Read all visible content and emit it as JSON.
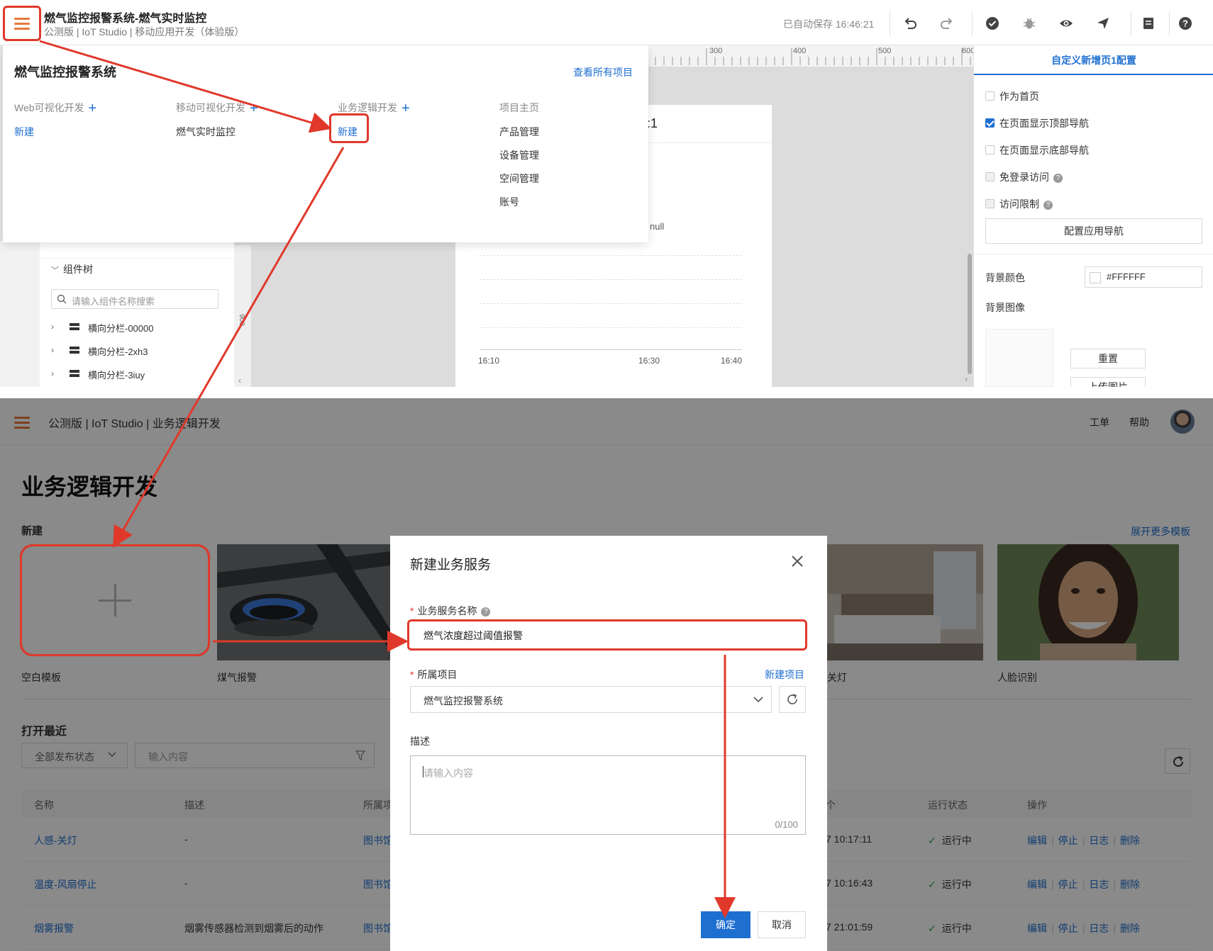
{
  "top": {
    "title": "燃气监控报警系统-燃气实时监控",
    "subtitle": "公测版 | IoT Studio | 移动应用开发（体验版）",
    "autosave": "已自动保存 16:46:21",
    "toolbar_icons": [
      "undo-icon",
      "redo-icon",
      "check-circle-icon",
      "bug-icon",
      "eye-icon",
      "send-icon",
      "document-icon",
      "help-icon"
    ],
    "ruler_ticks": [
      "300",
      "400",
      "500",
      "600"
    ],
    "canvas": {
      "page_header_fragment": ":1",
      "null_text": "null",
      "x_ticks": [
        "16:10",
        "16:30",
        "16:40"
      ],
      "vertical_ruler_label": "900"
    },
    "component_tree": {
      "title": "组件树",
      "search_placeholder": "请输入组件名称搜索",
      "items": [
        {
          "label": "横向分栏-00000"
        },
        {
          "label": "横向分栏-2xh3"
        },
        {
          "label": "横向分栏-3iuy"
        }
      ]
    },
    "right_panel": {
      "title": "自定义新增页1配置",
      "options": [
        {
          "label": "作为首页",
          "checked": false
        },
        {
          "label": "在页面显示顶部导航",
          "checked": true
        },
        {
          "label": "在页面显示底部导航",
          "checked": false
        },
        {
          "label": "免登录访问",
          "checked": false
        },
        {
          "label": "访问限制",
          "checked": false
        }
      ],
      "nav_button": "配置应用导航",
      "bg_color_label": "背景颜色",
      "bg_color_value": "#FFFFFF",
      "bg_image_label": "背景图像",
      "reset_button": "重置",
      "upload_button": "上传图片"
    },
    "dropdown": {
      "title": "燃气监控报警系统",
      "view_all": "查看所有项目",
      "columns": [
        {
          "heading": "Web可视化开发",
          "items": [
            "新建"
          ]
        },
        {
          "heading": "移动可视化开发",
          "items": [
            "燃气实时监控"
          ]
        },
        {
          "heading": "业务逻辑开发",
          "items": [
            "新建"
          ]
        },
        {
          "heading": "项目主页",
          "items": [
            "产品管理",
            "设备管理",
            "空间管理",
            "账号"
          ]
        }
      ]
    }
  },
  "bottom": {
    "breadcrumb": "公测版 | IoT Studio | 业务逻辑开发",
    "ticket": "工单",
    "help": "帮助",
    "page_title": "业务逻辑开发",
    "new_section": "新建",
    "more_templates": "展开更多模板",
    "templates": [
      {
        "label": "空白模板"
      },
      {
        "label": "煤气报警"
      },
      {
        "label": "关灯"
      },
      {
        "label": "人脸识别"
      }
    ],
    "recent_title": "打开最近",
    "status_filter": "全部发布状态",
    "search_placeholder": "输入内容",
    "table": {
      "headers": [
        "名称",
        "描述",
        "所属项",
        "个",
        "运行状态",
        "操作"
      ],
      "rows": [
        {
          "name": "人感-关灯",
          "desc": "-",
          "project": "图书馆",
          "time": "7 10:17:11",
          "status": "运行中"
        },
        {
          "name": "温度-风扇停止",
          "desc": "-",
          "project": "图书馆",
          "time": "7 10:16:43",
          "status": "运行中"
        },
        {
          "name": "烟雾报警",
          "desc": "烟雾传感器检测到烟雾后的动作",
          "project": "图书馆",
          "time": "7 21:01:59",
          "status": "运行中"
        }
      ],
      "actions": [
        "编辑",
        "停止",
        "日志",
        "删除"
      ]
    },
    "modal": {
      "title": "新建业务服务",
      "name_label": "业务服务名称",
      "name_value": "燃气浓度超过阈值报警",
      "project_label": "所属项目",
      "new_project": "新建项目",
      "project_value": "燃气监控报警系统",
      "desc_label": "描述",
      "desc_placeholder": "请输入内容",
      "desc_counter": "0/100",
      "ok": "确定",
      "cancel": "取消"
    }
  },
  "colors": {
    "annotation_red": "#e0392b",
    "link_blue": "#1f6fd1",
    "menu_orange": "#e8793a",
    "running_green": "#2aa44f"
  }
}
